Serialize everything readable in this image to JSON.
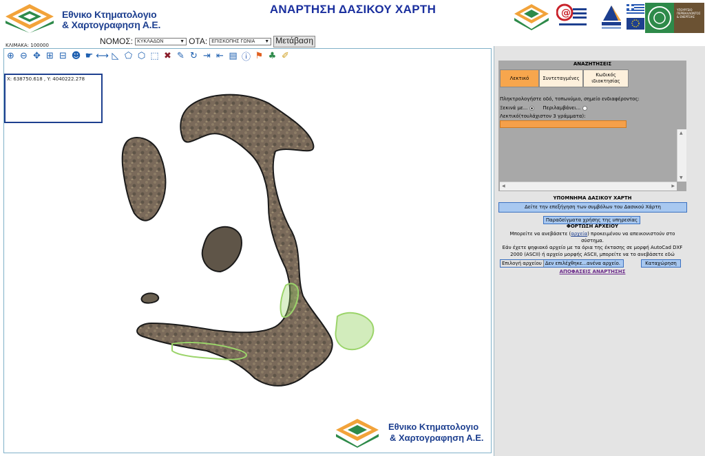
{
  "header": {
    "title": "ΑΝΑΡΤΗΣΗ ΔΑΣΙΚΟΥ ΧΑΡΤΗ",
    "org_line1": "Εθνικο Κτηματολογιο",
    "org_line2": "& Χαρτογραφηση Α.Ε.",
    "partner_logos": [
      "ktimatologio-logo",
      "e-services-logo",
      "elliniki-dimokratia-logo",
      "greek-eu-flags",
      "ministry-environment-logo"
    ],
    "ministry_text": "ΥΠΟΥΡΓΕΙΟ ΠΕΡΙΒΑΛΛΟΝΤΟΣ & ΕΝΕΡΓΕΙΑΣ",
    "ellada_text": "ΕΛΛΑΔΑ 2.0"
  },
  "controls": {
    "nomos_label": "ΝΟΜΟΣ:",
    "nomos_value": "ΚΥΚΛΑΔΩΝ",
    "ota_label": "ΟΤΑ:",
    "ota_value": "ΕΠΙΣΚΟΠΗΣ ΓΩΝΙΑ",
    "go_label": "Μετάβαση",
    "scale_text": "ΚΛΙΜΑΚΑ: 100000"
  },
  "toolbar": {
    "tools": [
      "zoom-in-icon",
      "zoom-out-icon",
      "pan-icon",
      "zoom-box-icon",
      "zoom-out-box-icon",
      "identify-icon",
      "info-hand-icon",
      "measure-distance-icon",
      "measure-area-icon",
      "polygon-icon",
      "select-polygon-icon",
      "select-box-icon",
      "clear-icon",
      "edit-icon",
      "refresh-icon",
      "xy-go-icon",
      "xy-find-icon",
      "print-icon",
      "info-icon",
      "flag-icon",
      "tree-icon",
      "eraser-icon"
    ]
  },
  "map": {
    "coords": "X: 638750.618 , Y: 4040222.278"
  },
  "search": {
    "title": "ΑΝΑΖΗΤΗΣΕΙΣ",
    "tabs": [
      {
        "label": "Λεκτικό",
        "active": true
      },
      {
        "label": "Συντεταγμένες",
        "active": false
      },
      {
        "label": "Κωδικός ιδιοκτησίας",
        "active": false
      }
    ],
    "prompt": "Πληκτρολογήστε οδό, τοπωνύμιο, σημείο ενδιαφέροντος:",
    "radio1": "Ξεκινά με...",
    "radio2": "Περιλαμβάνει...",
    "input_label": "Λεκτικό(τουλάχιστον 3 γράμματα):",
    "input_value": ""
  },
  "legend": {
    "title": "ΥΠΟΜΝΗΜΑ ΔΑΣΙΚΟΥ ΧΑΡΤΗ",
    "button": "Δείτε την επεξήγηση των συμβόλων του Δασικού Χάρτη",
    "examples": "Παραδείγματα χρήσης της υπηρεσίας"
  },
  "upload": {
    "title": "ΦΟΡΤΩΣΗ ΑΡΧΕΙΟΥ",
    "text1_before": "Μπορείτε να ανεβάσετε (",
    "text1_link": "αρχεία",
    "text1_after": ") προκειμένου να απεικονιστούν στο σύστημα.",
    "text2": "Εάν έχετε ψηφιακό αρχείο με τα όρια της έκτασης σε μορφή AutoCad DXF 2000 (ASCII) ή αρχείο μορφής ASCII, μπορείτε να το ανεβάσετε εδώ",
    "choose_file": "Επιλογή αρχείου",
    "no_file": "Δεν επιλέχθηκε...ανένα αρχείο.",
    "submit": "Καταχώρηση",
    "decisions_link": "ΑΠΟΦΑΣΕΙΣ ΑΝΑΡΤΗΣΗΣ"
  },
  "colors": {
    "brand_blue": "#1d3f8f",
    "active_tab": "#f7a64d",
    "button_blue": "#a8c8f0",
    "panel_gray": "#a8a8a8",
    "forest_green": "#9bd46a"
  }
}
